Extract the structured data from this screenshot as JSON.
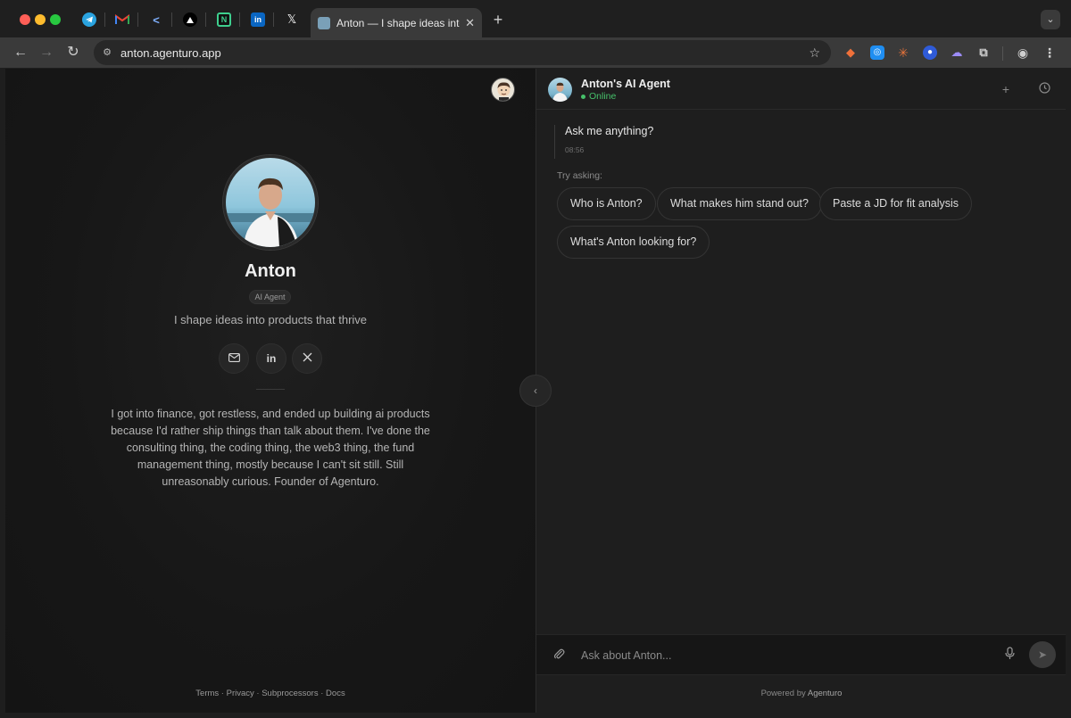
{
  "browser": {
    "active_tab_title": "Anton — I shape ideas into pr",
    "url": "anton.agenturo.app",
    "new_tab": "+",
    "tab_close": "✕"
  },
  "profile": {
    "name": "Anton",
    "badge": "AI Agent",
    "tagline": "I shape ideas into products that thrive",
    "bio": "I got into finance, got restless, and ended up building ai products because I'd rather ship things than talk about them. I've done the consulting thing, the coding thing, the web3 thing, the fund management thing, mostly because I can't sit still. Still unreasonably curious. Founder of Agenturo.",
    "socials": [
      "email-icon",
      "linkedin-icon",
      "x-icon"
    ]
  },
  "footer": {
    "links": [
      "Terms",
      "Privacy",
      "Subprocessors",
      "Docs"
    ],
    "separator": "·"
  },
  "chat": {
    "agent_name": "Anton's AI Agent",
    "status": "Online",
    "status_color": "#46c06a",
    "messages": [
      {
        "text": "Ask me anything?",
        "time": "08:56"
      }
    ],
    "try_label": "Try asking:",
    "suggestions": [
      "Who is Anton?",
      "What makes him stand out?",
      "Paste a JD for fit analysis",
      "What's Anton looking for?"
    ],
    "input_placeholder": "Ask about Anton...",
    "powered_prefix": "Powered by",
    "powered_brand": "Agenturo"
  }
}
